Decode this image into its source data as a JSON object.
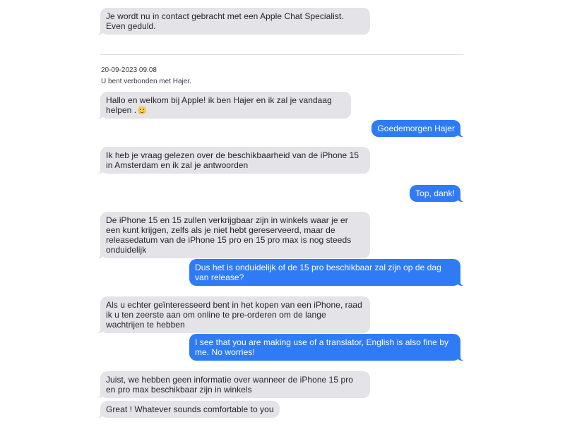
{
  "conversation": {
    "messages_before": [
      {
        "text": "Je wordt nu in contact gebracht met een Apple Chat Specialist. Even geduld."
      }
    ],
    "session": {
      "timestamp": "20-09-2023 09:08",
      "connected_text": "U bent verbonden met Hajer."
    },
    "messages": [
      {
        "sender": "agent",
        "text": "Hallo en welkom bij Apple! ik ben Hajer en ik zal je vandaag helpen .",
        "emoji": "smiling-face-icon"
      },
      {
        "sender": "user",
        "text": "Goedemorgen Hajer"
      },
      {
        "sender": "agent",
        "text": "Ik heb je vraag gelezen over de beschikbaarheid van de iPhone 15 in Amsterdam en ik zal je antwoorden"
      },
      {
        "sender": "user",
        "text": "Top, dank!"
      },
      {
        "sender": "agent",
        "text": "De iPhone 15 en 15 zullen verkrijgbaar zijn in winkels waar je er een kunt krijgen, zelfs als je niet hebt gereserveerd, maar de releasedatum van de iPhone 15 pro en 15 pro max is nog steeds onduidelijk"
      },
      {
        "sender": "user",
        "text": "Dus het is onduidelijk of de 15 pro beschikbaar zal zijn op de dag van release?"
      },
      {
        "sender": "agent",
        "text": "Als u echter geïnteresseerd bent in het kopen van een iPhone, raad ik u ten zeerste aan om online te pre-orderen om de lange wachtrijen te hebben"
      },
      {
        "sender": "user",
        "text": "I see that you are making use of a translator, English is also fine by me. No worries!"
      },
      {
        "sender": "agent",
        "text": "Juist, we hebben geen informatie over wanneer de iPhone 15 pro en pro max beschikbaar zijn in winkels"
      },
      {
        "sender": "agent",
        "text": "Great ! Whatever sounds comfortable to you"
      }
    ]
  },
  "colors": {
    "incoming_bubble": "#e3e3e8",
    "outgoing_bubble": "#2f7bf6",
    "incoming_text": "#262626",
    "outgoing_text": "#ffffff"
  }
}
